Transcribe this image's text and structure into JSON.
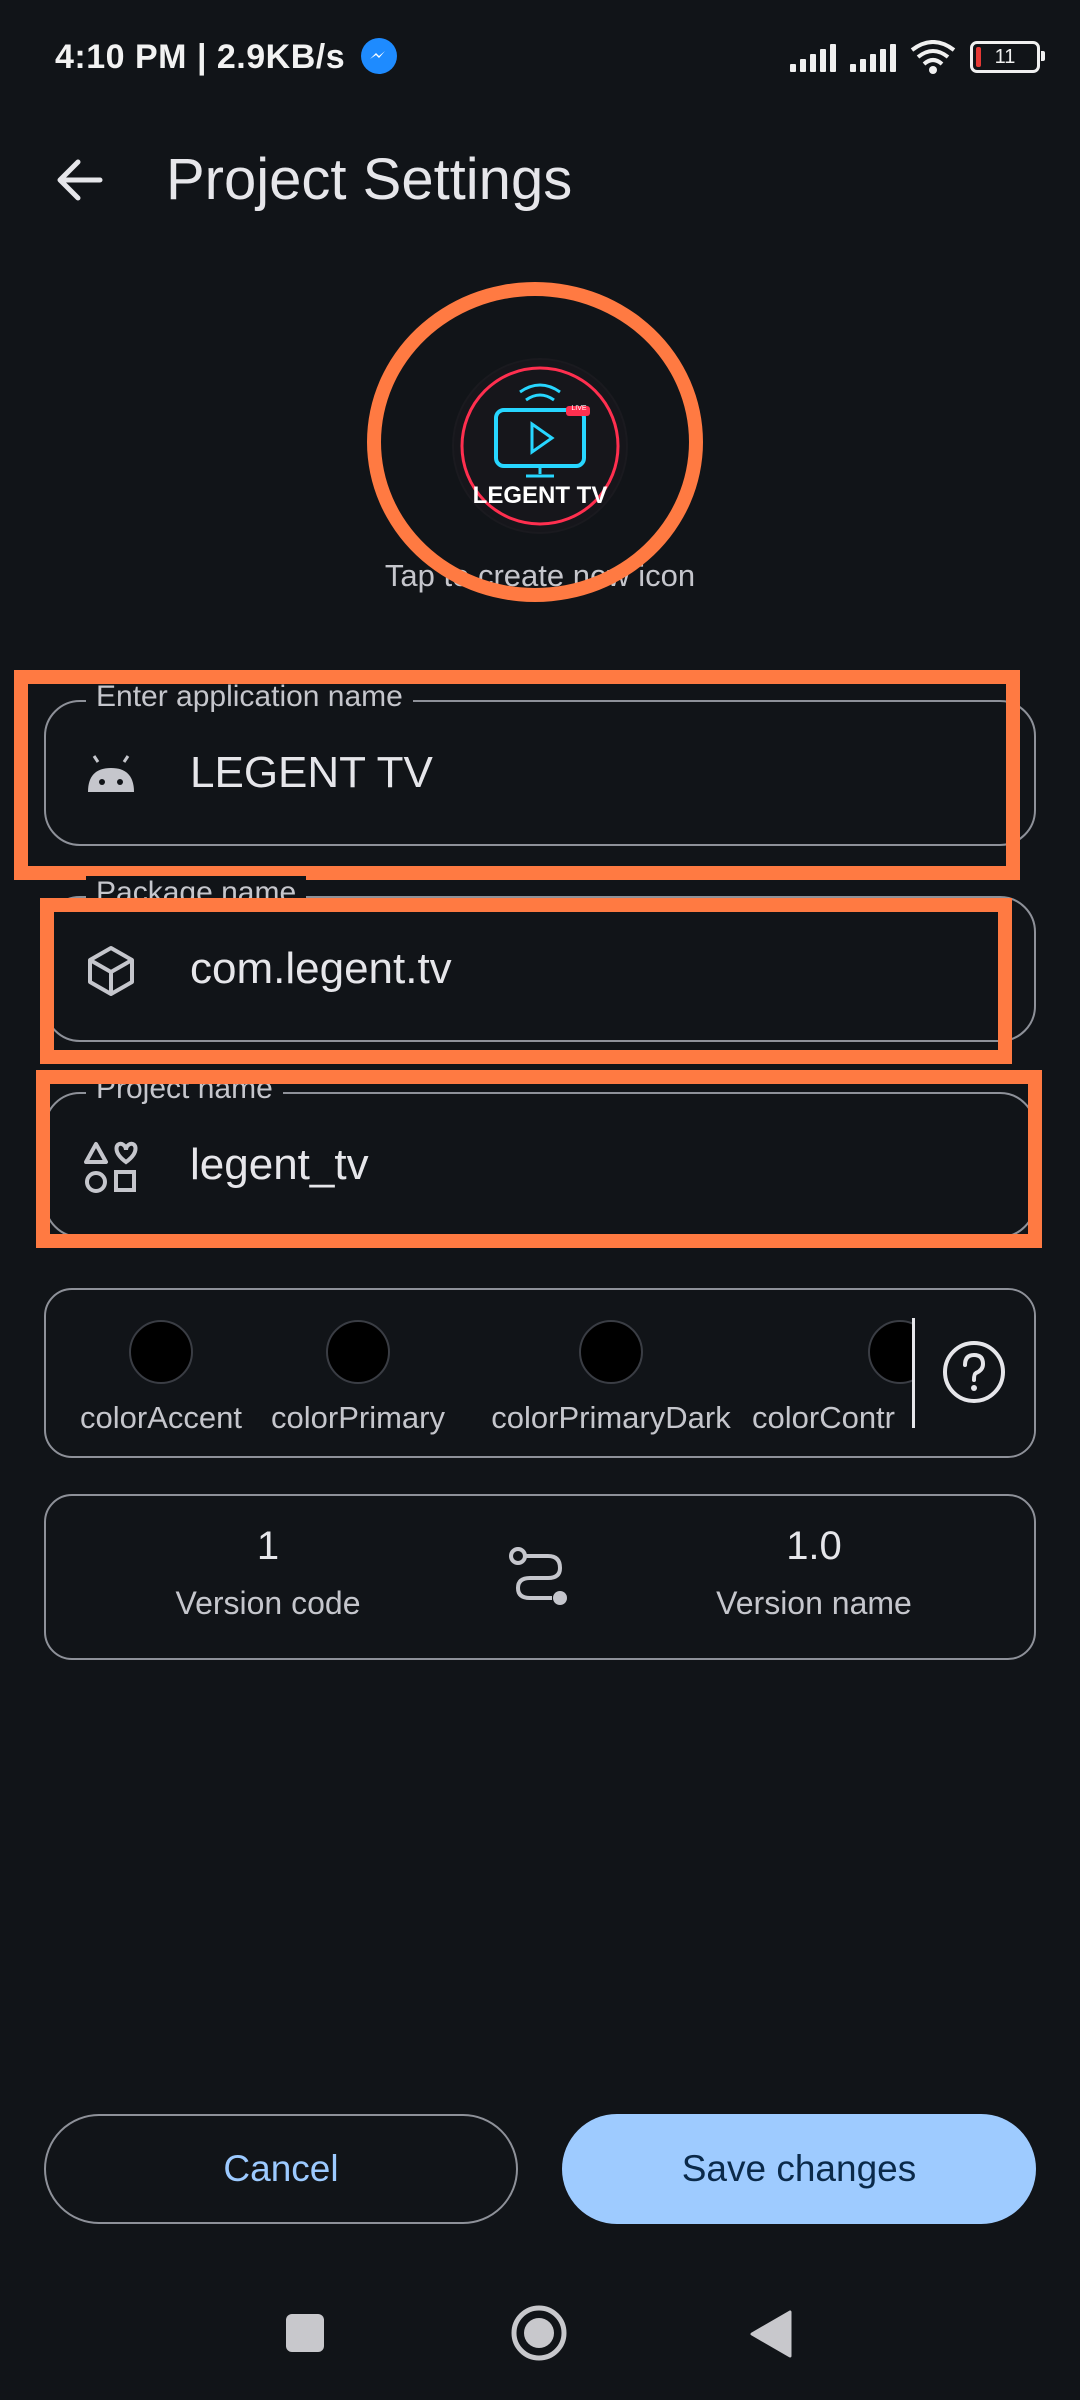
{
  "status_bar": {
    "time": "4:10 PM | 2.9KB/s",
    "battery_level": "11"
  },
  "header": {
    "title": "Project Settings"
  },
  "icon_section": {
    "icon_text": "LEGENT TV",
    "icon_badge": "LIVE",
    "caption": "Tap to create new icon"
  },
  "fields": {
    "app_name": {
      "label": "Enter application name",
      "value": "LEGENT TV"
    },
    "package_name": {
      "label": "Package name",
      "value": "com.legent.tv"
    },
    "project_name": {
      "label": "Project name",
      "value": "legent_tv"
    }
  },
  "colors": {
    "items": [
      {
        "label": "colorAccent",
        "color": "#000000"
      },
      {
        "label": "colorPrimary",
        "color": "#000000"
      },
      {
        "label": "colorPrimaryDark",
        "color": "#000000"
      },
      {
        "label": "colorContr",
        "color": "#000000"
      }
    ]
  },
  "version": {
    "code_value": "1",
    "code_label": "Version code",
    "name_value": "1.0",
    "name_label": "Version name"
  },
  "buttons": {
    "cancel": "Cancel",
    "save": "Save changes"
  },
  "theme": {
    "highlight": "#ff7a42",
    "accent": "#9ecbff",
    "background": "#111418"
  }
}
